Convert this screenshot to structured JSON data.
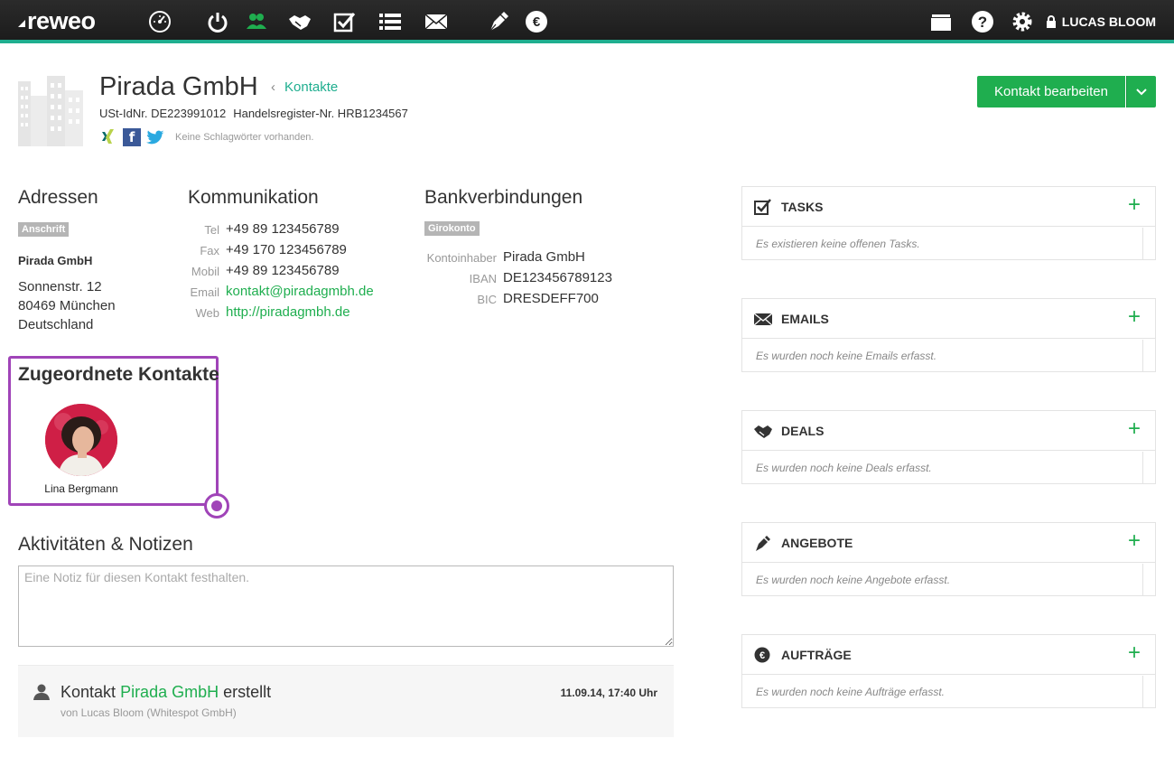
{
  "app": {
    "logo": "reweo",
    "user_name": "LUCAS BLOOM"
  },
  "nav": {
    "icons": [
      "dashboard-icon",
      "power-icon",
      "contacts-icon",
      "deals-icon",
      "tasks-icon",
      "list-icon",
      "mail-icon",
      "pen-icon",
      "euro-icon"
    ],
    "right_icons": [
      "archive-icon",
      "help-icon",
      "gear-icon",
      "lock-icon"
    ],
    "accent": "#1fae8f"
  },
  "header": {
    "title": "Pirada GmbH",
    "breadcrumb": "Kontakte",
    "vat": "USt-IdNr. DE223991012",
    "register": "Handelsregister-Nr. HRB1234567",
    "no_tags": "Keine Schlagwörter vorhanden.",
    "edit_button": "Kontakt bearbeiten"
  },
  "addresses": {
    "heading": "Adressen",
    "tag": "Anschrift",
    "name": "Pirada GmbH",
    "street": "Sonnenstr. 12",
    "city": "80469 München",
    "country": "Deutschland"
  },
  "communication": {
    "heading": "Kommunikation",
    "rows": [
      {
        "label": "Tel",
        "value": "+49 89 123456789"
      },
      {
        "label": "Fax",
        "value": "+49 170 123456789"
      },
      {
        "label": "Mobil",
        "value": "+49 89 123456789"
      },
      {
        "label": "Email",
        "value": "kontakt@piradagmbh.de"
      },
      {
        "label": "Web",
        "value": "http://piradagmbh.de"
      }
    ]
  },
  "bank": {
    "heading": "Bankverbindungen",
    "tag": "Girokonto",
    "rows": [
      {
        "label": "Kontoinhaber",
        "value": "Pirada GmbH"
      },
      {
        "label": "IBAN",
        "value": "DE123456789123"
      },
      {
        "label": "BIC",
        "value": "DRESDEFF700"
      }
    ]
  },
  "assigned": {
    "heading": "Zugeordnete Kontakte",
    "contact_name": "Lina Bergmann"
  },
  "activities": {
    "heading": "Aktivitäten & Notizen",
    "note_placeholder": "Eine Notiz für diesen Kontakt festhalten.",
    "entry": {
      "prefix": "Kontakt",
      "link": "Pirada GmbH",
      "suffix": "erstellt",
      "sub": "von Lucas Bloom (Whitespot GmbH)",
      "time": "11.09.14, 17:40 Uhr"
    }
  },
  "panels": [
    {
      "title": "TASKS",
      "icon": "tasks-icon",
      "empty": "Es existieren keine offenen Tasks."
    },
    {
      "title": "EMAILS",
      "icon": "mail-icon",
      "empty": "Es wurden noch keine Emails erfasst."
    },
    {
      "title": "DEALS",
      "icon": "deals-icon",
      "empty": "Es wurden noch keine Deals erfasst."
    },
    {
      "title": "ANGEBOTE",
      "icon": "pen-icon",
      "empty": "Es wurden noch keine Angebote erfasst."
    },
    {
      "title": "AUFTRÄGE",
      "icon": "euro-icon",
      "empty": "Es wurden noch keine Aufträge erfasst."
    }
  ]
}
